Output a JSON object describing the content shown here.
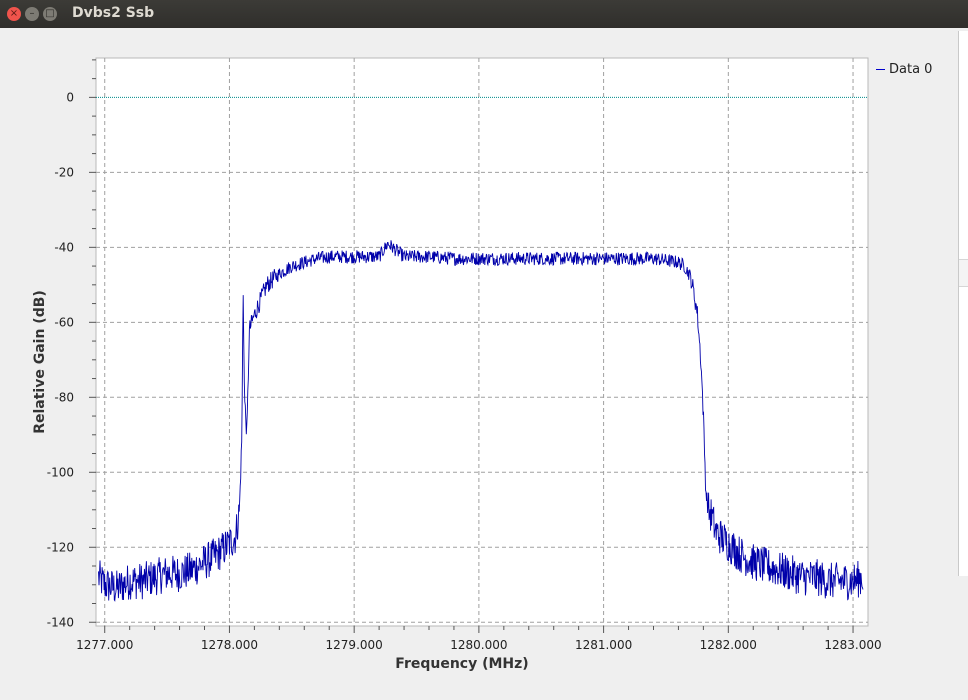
{
  "window": {
    "title": "Dvbs2 Ssb",
    "close_glyph": "×",
    "minimize_glyph": "–",
    "maximize_glyph": "□"
  },
  "legend": {
    "entries": [
      "Data 0"
    ]
  },
  "colors": {
    "trace": "#0000aa",
    "reference_line": "#008b8b",
    "grid": "#a0a0a0",
    "plot_bg": "#ffffff",
    "window_bg": "#efefef"
  },
  "chart_data": {
    "type": "line",
    "title": "",
    "xlabel": "Frequency (MHz)",
    "ylabel": "Relative Gain (dB)",
    "xlim": [
      1276.93,
      1283.12
    ],
    "ylim": [
      -141,
      10.5
    ],
    "x_ticks": [
      1277.0,
      1278.0,
      1279.0,
      1280.0,
      1281.0,
      1282.0,
      1283.0
    ],
    "x_tick_labels": [
      "1277.000",
      "1278.000",
      "1279.000",
      "1280.000",
      "1281.000",
      "1282.000",
      "1283.000"
    ],
    "y_ticks": [
      0,
      -20,
      -40,
      -60,
      -80,
      -100,
      -120,
      -140
    ],
    "y_tick_labels": [
      "0",
      "-20",
      "-40",
      "-60",
      "-80",
      "-100",
      "-120",
      "-140"
    ],
    "grid": true,
    "legend_position": "right",
    "reference_line": {
      "y": 0
    },
    "series": [
      {
        "name": "Data 0",
        "x": [
          1276.95,
          1277.0,
          1277.1,
          1277.2,
          1277.3,
          1277.4,
          1277.5,
          1277.6,
          1277.7,
          1277.8,
          1277.9,
          1278.0,
          1278.05,
          1278.08,
          1278.1,
          1278.11,
          1278.12,
          1278.14,
          1278.16,
          1278.2,
          1278.25,
          1278.3,
          1278.4,
          1278.5,
          1278.6,
          1278.7,
          1278.8,
          1279.0,
          1279.2,
          1279.27,
          1279.4,
          1279.6,
          1279.8,
          1280.0,
          1280.2,
          1280.4,
          1280.6,
          1280.8,
          1281.0,
          1281.2,
          1281.4,
          1281.5,
          1281.6,
          1281.65,
          1281.7,
          1281.75,
          1281.78,
          1281.8,
          1281.82,
          1281.84,
          1281.87,
          1281.9,
          1282.0,
          1282.1,
          1282.2,
          1282.3,
          1282.4,
          1282.5,
          1282.6,
          1282.7,
          1282.8,
          1282.9,
          1283.0,
          1283.08
        ],
        "y": [
          -128,
          -130,
          -131,
          -129,
          -129,
          -128,
          -127,
          -127,
          -126,
          -124,
          -122,
          -119,
          -117,
          -110,
          -90,
          -50,
          -80,
          -90,
          -62,
          -58,
          -54,
          -50,
          -47,
          -45,
          -44,
          -43,
          -42.5,
          -42.5,
          -42.5,
          -39,
          -42.5,
          -42.5,
          -43,
          -43,
          -43,
          -43,
          -43,
          -43,
          -43,
          -43,
          -43,
          -43.5,
          -44,
          -45,
          -48,
          -57,
          -70,
          -85,
          -105,
          -110,
          -112,
          -116,
          -119,
          -122,
          -124,
          -125,
          -126,
          -127,
          -128,
          -128,
          -129,
          -129,
          -129,
          -128
        ]
      }
    ]
  }
}
